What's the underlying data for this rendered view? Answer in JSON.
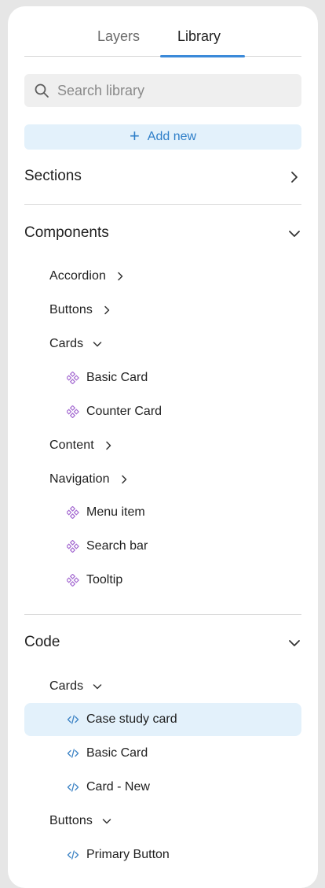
{
  "tabs": [
    {
      "label": "Layers",
      "active": false
    },
    {
      "label": "Library",
      "active": true
    }
  ],
  "search": {
    "placeholder": "Search library",
    "value": ""
  },
  "add_new": {
    "label": "Add new"
  },
  "sections": {
    "sections": {
      "title": "Sections",
      "expanded": false
    },
    "components": {
      "title": "Components",
      "expanded": true,
      "groups": [
        {
          "label": "Accordion",
          "expanded": false
        },
        {
          "label": "Buttons",
          "expanded": false
        },
        {
          "label": "Cards",
          "expanded": true,
          "items": [
            "Basic Card",
            "Counter Card"
          ]
        },
        {
          "label": "Content",
          "expanded": false
        },
        {
          "label": "Navigation",
          "expanded": false,
          "items": [
            "Menu item",
            "Search bar",
            "Tooltip"
          ]
        }
      ]
    },
    "code": {
      "title": "Code",
      "expanded": true,
      "groups": [
        {
          "label": "Cards",
          "expanded": true,
          "items": [
            "Case study card",
            "Basic Card",
            "Card - New"
          ]
        },
        {
          "label": "Buttons",
          "expanded": true,
          "items": [
            "Primary Button"
          ]
        }
      ],
      "selected_item": "Case study card"
    }
  },
  "colors": {
    "accent": "#3b8ad9",
    "selection_bg": "#e3f1fb",
    "component_icon": "#a56bd1",
    "code_icon": "#3b82c4"
  },
  "icons": {
    "search": "search-icon",
    "plus": "plus-icon",
    "chevron_right": "chevron-right-icon",
    "chevron_down": "chevron-down-icon",
    "component": "component-icon",
    "code": "code-icon"
  }
}
